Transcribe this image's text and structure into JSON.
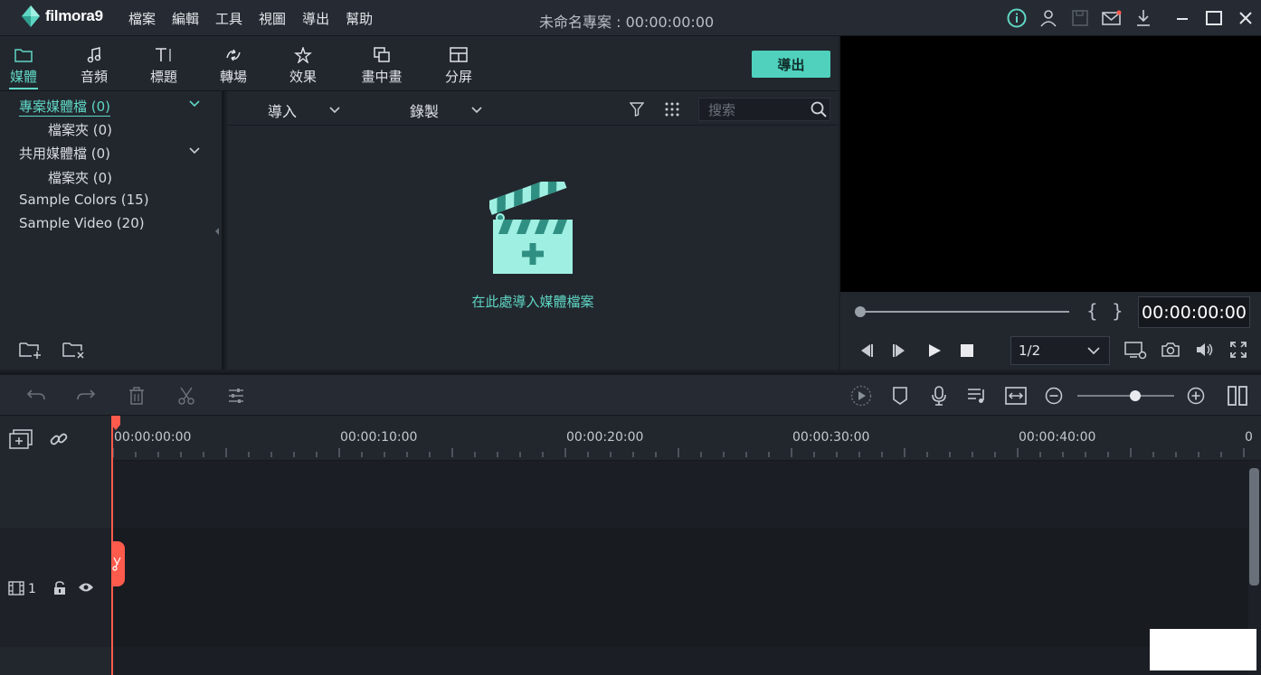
{
  "app": {
    "logo_text": "filmora9",
    "document_title": "未命名專案 : 00:00:00:00"
  },
  "menu": [
    "檔案",
    "編輯",
    "工具",
    "視圖",
    "導出",
    "幫助"
  ],
  "media_tabs": [
    {
      "label": "媒體",
      "icon": "folder-icon",
      "active": true
    },
    {
      "label": "音頻",
      "icon": "music-note-icon",
      "active": false
    },
    {
      "label": "標題",
      "icon": "text-title-icon",
      "active": false
    },
    {
      "label": "轉場",
      "icon": "transition-icon",
      "active": false
    },
    {
      "label": "效果",
      "icon": "effects-star-icon",
      "active": false
    },
    {
      "label": "畫中畫",
      "icon": "pip-icon",
      "active": false
    },
    {
      "label": "分屏",
      "icon": "split-screen-icon",
      "active": false
    }
  ],
  "export_button": "導出",
  "library": {
    "items": [
      {
        "label": "專案媒體檔 (0)",
        "selected": true
      },
      {
        "label": "檔案夾 (0)"
      },
      {
        "label": "共用媒體檔 (0)"
      },
      {
        "label": "檔案夾 (0)"
      },
      {
        "label": "Sample Colors (15)"
      },
      {
        "label": "Sample Video (20)"
      }
    ]
  },
  "media_toolbar": {
    "import_label": "導入",
    "record_label": "錄製",
    "search_placeholder": "搜索"
  },
  "media_empty_text": "在此處導入媒體檔案",
  "preview": {
    "timecode": "00:00:00:00",
    "ratio": "1/2",
    "mark_in": "{",
    "mark_out": "}"
  },
  "ruler_labels": [
    "00:00:00:00",
    "00:00:10:00",
    "00:00:20:00",
    "00:00:30:00",
    "00:00:40:00",
    "0"
  ],
  "track": {
    "number": "1"
  },
  "colors": {
    "accent": "#5fd6c4",
    "playhead": "#ff5b4d",
    "bg": "#22272e"
  }
}
